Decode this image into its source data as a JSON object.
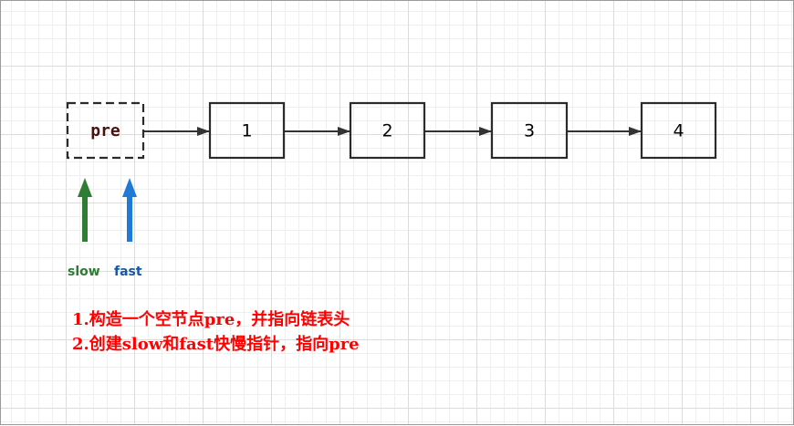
{
  "nodes": [
    {
      "label": "pre"
    },
    {
      "label": "1"
    },
    {
      "label": "2"
    },
    {
      "label": "3"
    },
    {
      "label": "4"
    }
  ],
  "pointers": {
    "slow": {
      "label": "slow",
      "color": "#2e7d32"
    },
    "fast": {
      "label": "fast",
      "color": "#1565c0"
    }
  },
  "notes": [
    "1.构造一个空节点pre，并指向链表头",
    "2.创建slow和fast快慢指针，指向pre"
  ],
  "colors": {
    "node_border": "#2b2b2b",
    "arrow": "#333333",
    "note_text": "#ff0000"
  }
}
